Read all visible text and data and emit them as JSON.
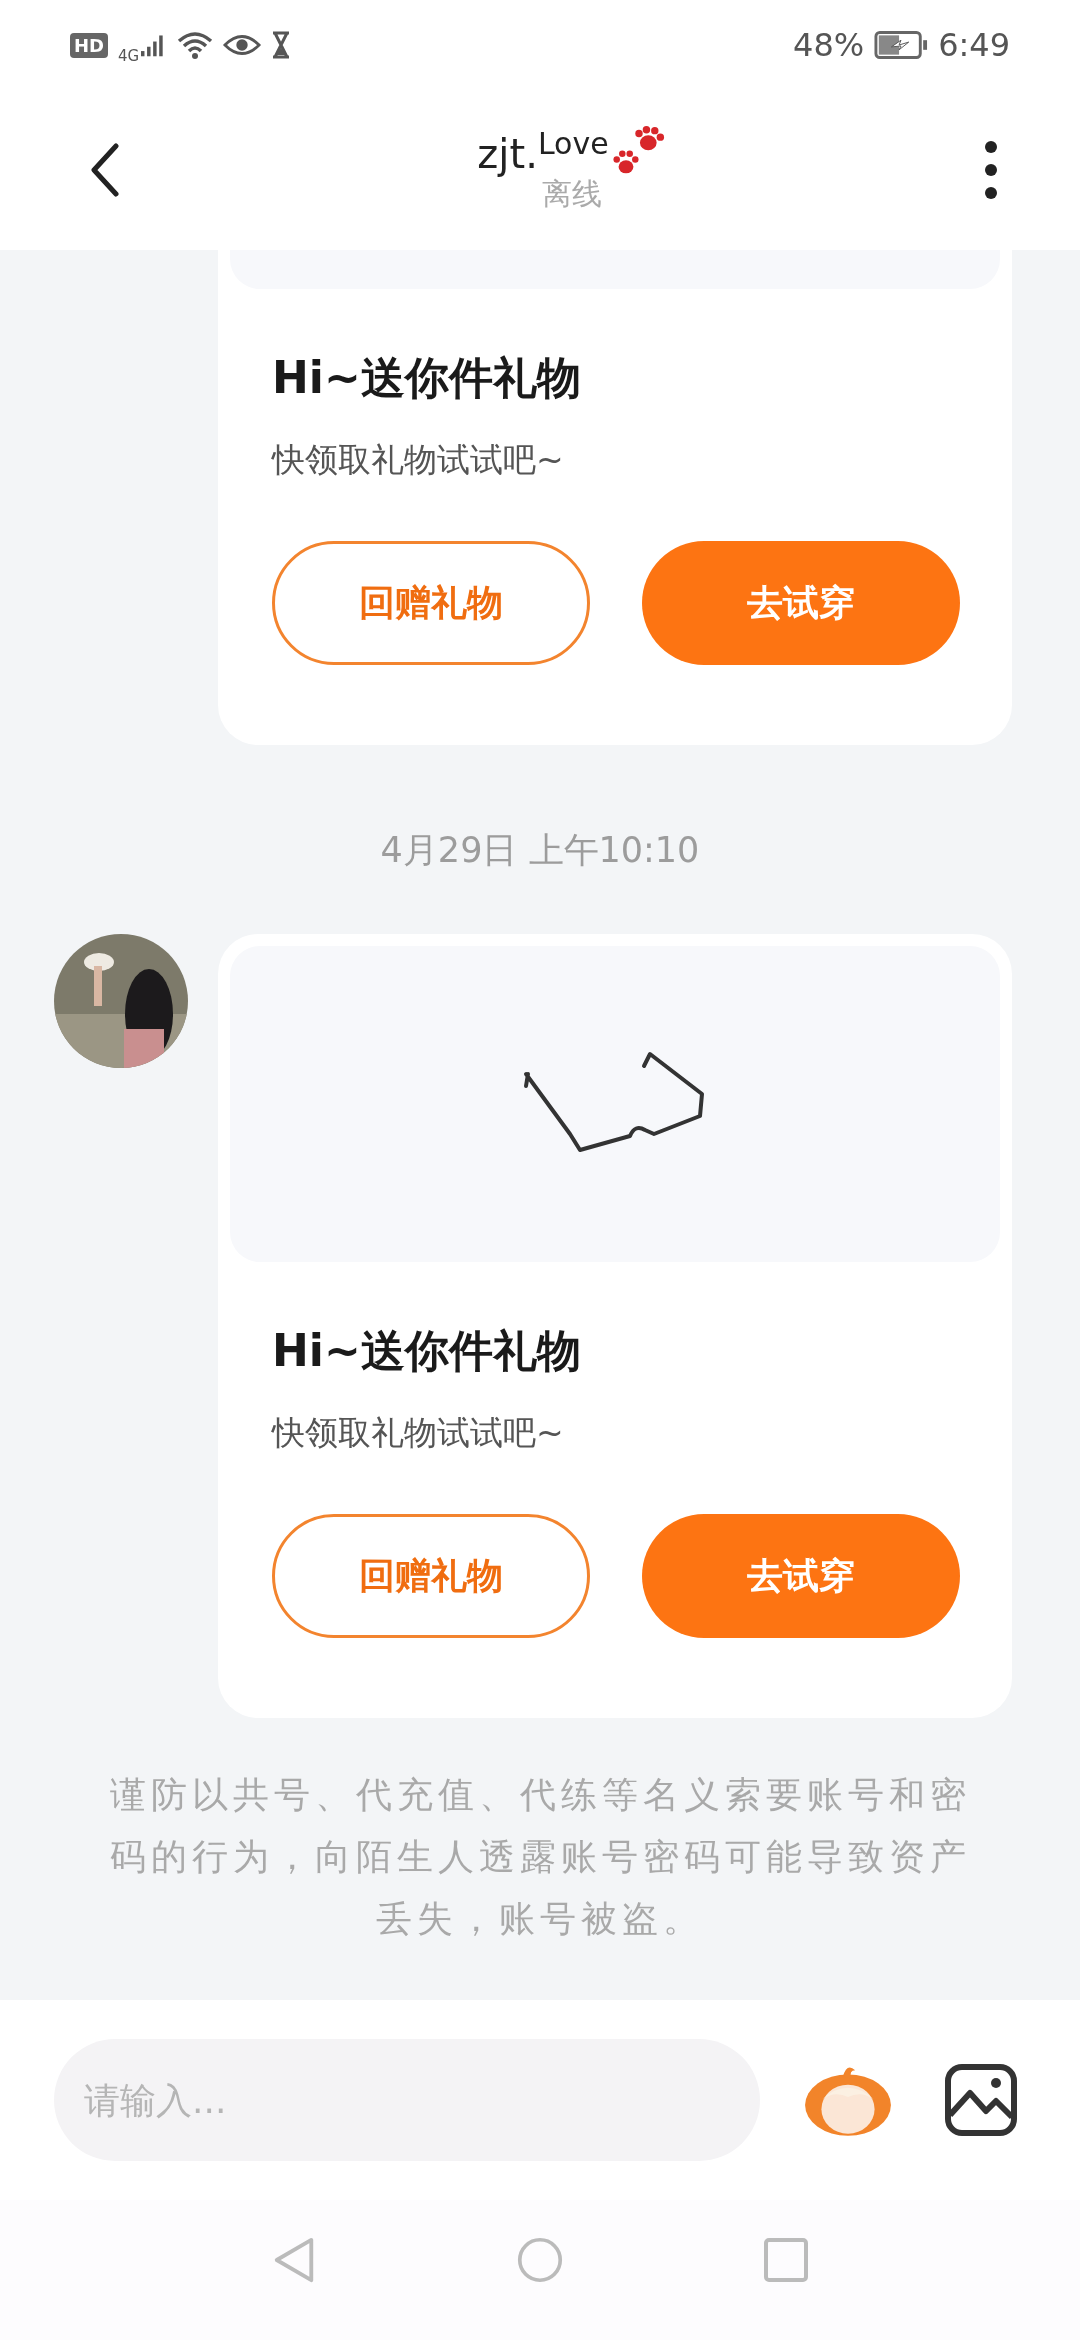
{
  "status_bar": {
    "hd": "HD",
    "network": "4G",
    "battery": "48%",
    "time": "6:49"
  },
  "header": {
    "title": "zjt.$^{Love}$",
    "status": "离线"
  },
  "messages": [
    {
      "kind": "gift_partial",
      "title": "Hi~送你件礼物",
      "subtitle": "快领取礼物试试吧~",
      "buttons": [
        {
          "label": "回赠礼物",
          "kind": "outline"
        },
        {
          "label": "去试穿",
          "kind": "filled"
        }
      ]
    },
    {
      "kind": "time",
      "text": "4月29日 上午10:10"
    },
    {
      "kind": "gift",
      "avatar": true,
      "title": "Hi~送你件礼物",
      "subtitle": "快领取礼物试试吧~",
      "buttons": [
        {
          "label": "回赠礼物",
          "kind": "outline"
        },
        {
          "label": "去试穿",
          "kind": "filled"
        }
      ]
    }
  ],
  "notice": "谨防以共号、代充值、代练等名义索要账号和密码的行为，向陌生人透露账号密码可能导致资产丢失，账号被盗。",
  "input": {
    "placeholder": "请输入..."
  }
}
